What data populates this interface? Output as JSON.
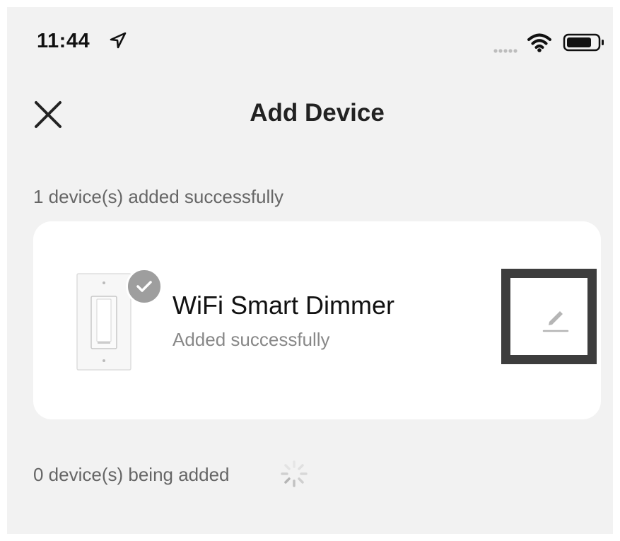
{
  "status_bar": {
    "time": "11:44",
    "icons": [
      "location-arrow-icon",
      "cellular-signal-icon",
      "wifi-icon",
      "battery-icon"
    ]
  },
  "header": {
    "title": "Add Device",
    "close_icon": "close-icon"
  },
  "added_section": {
    "label": "1 device(s) added successfully"
  },
  "device": {
    "name": "WiFi Smart Dimmer",
    "status": "Added successfully",
    "image_icon": "wall-dimmer-switch",
    "badge_icon": "check-icon",
    "action_icon": "edit-pencil-icon"
  },
  "adding_section": {
    "label": "0 device(s) being added",
    "indicator_icon": "loading-spinner-icon"
  },
  "colors": {
    "background": "#f2f2f2",
    "card": "#ffffff",
    "title_text": "#222222",
    "secondary_text": "#666666",
    "badge": "#9e9e9e",
    "highlight_border": "#3d3d3d"
  }
}
